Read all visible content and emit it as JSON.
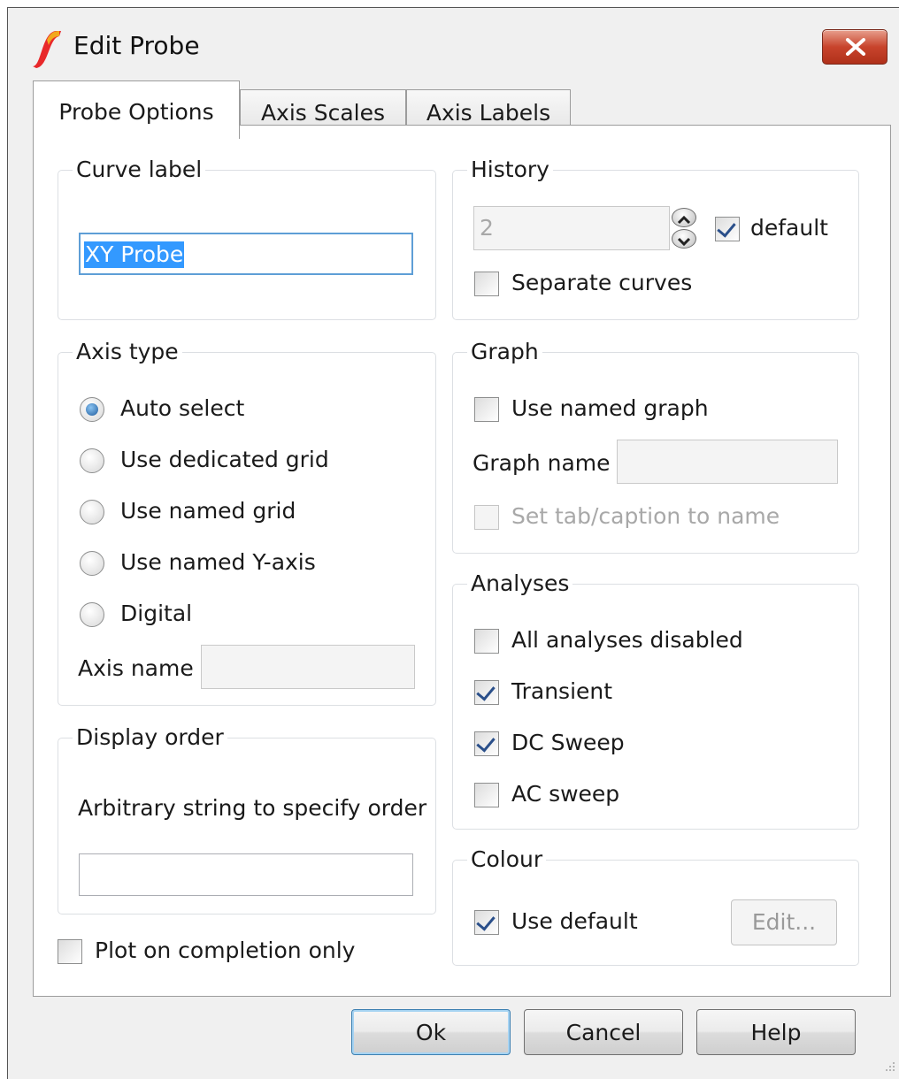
{
  "window": {
    "title": "Edit Probe"
  },
  "tabs": [
    {
      "label": "Probe Options",
      "active": true
    },
    {
      "label": "Axis Scales",
      "active": false
    },
    {
      "label": "Axis Labels",
      "active": false
    }
  ],
  "curve_label": {
    "group_title": "Curve label",
    "value": "XY Probe"
  },
  "history": {
    "group_title": "History",
    "value": "2",
    "default_label": "default",
    "default_checked": true,
    "separate_label": "Separate curves",
    "separate_checked": false
  },
  "axis_type": {
    "group_title": "Axis type",
    "options": [
      {
        "label": "Auto select",
        "selected": true
      },
      {
        "label": "Use dedicated grid",
        "selected": false
      },
      {
        "label": "Use named grid",
        "selected": false
      },
      {
        "label": "Use named Y-axis",
        "selected": false
      },
      {
        "label": "Digital",
        "selected": false
      }
    ],
    "axis_name_label": "Axis name",
    "axis_name_value": ""
  },
  "graph": {
    "group_title": "Graph",
    "use_named_label": "Use named graph",
    "use_named_checked": false,
    "graph_name_label": "Graph name",
    "graph_name_value": "",
    "set_tab_label": "Set tab/caption to name",
    "set_tab_checked": false
  },
  "analyses": {
    "group_title": "Analyses",
    "items": [
      {
        "label": "All analyses disabled",
        "checked": false
      },
      {
        "label": "Transient",
        "checked": true
      },
      {
        "label": "DC Sweep",
        "checked": true
      },
      {
        "label": "AC sweep",
        "checked": false
      }
    ]
  },
  "display_order": {
    "group_title": "Display order",
    "description": "Arbitrary string to specify order",
    "value": ""
  },
  "colour": {
    "group_title": "Colour",
    "use_default_label": "Use default",
    "use_default_checked": true,
    "edit_label": "Edit..."
  },
  "plot_on_completion": {
    "label": "Plot on completion only",
    "checked": false
  },
  "buttons": {
    "ok": "Ok",
    "cancel": "Cancel",
    "help": "Help"
  },
  "colors": {
    "dialog_bg": "#f0f0f0",
    "selection": "#3399ff",
    "close_button": "#c8442c",
    "check_mark": "#2a4f8a"
  }
}
